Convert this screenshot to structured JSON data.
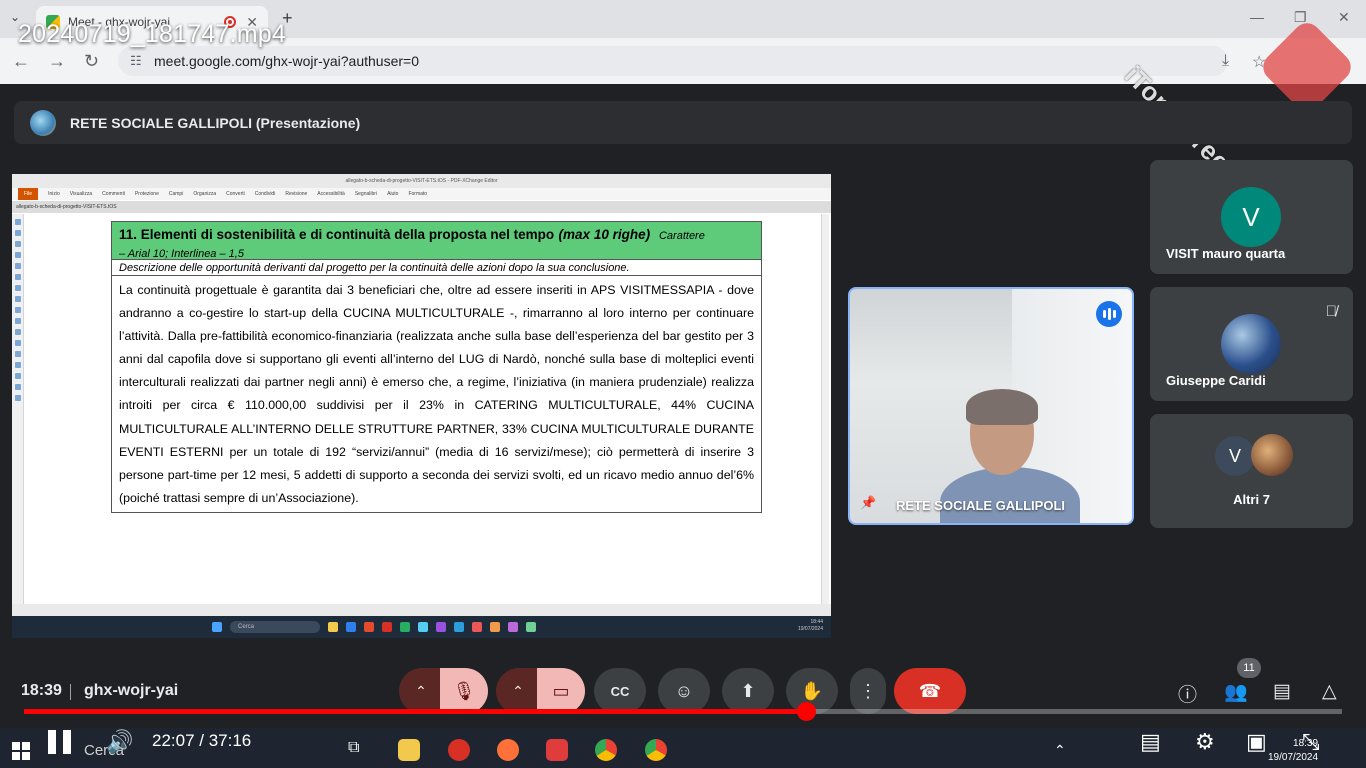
{
  "browser": {
    "tab_title": "Meet - ghx-wojr-yai",
    "url": "meet.google.com/ghx-wojr-yai?authuser=0",
    "tab_close": "✕",
    "new_tab": "+",
    "back": "←",
    "forward": "→",
    "reload": "↻",
    "minimize": "—",
    "maximize": "❐",
    "close": "✕"
  },
  "video": {
    "filename": "20240719_181747.mp4",
    "current_time": "22:07",
    "duration": "37:16",
    "time_display": "22:07 / 37:16",
    "progress_fraction": 0.593
  },
  "meet": {
    "meeting_title": "RETE SOCIALE GALLIPOLI (Presentazione)",
    "clock": "18:39",
    "meeting_code": "ghx-wojr-yai",
    "participants_count": "11"
  },
  "presentation": {
    "pdf_window_title": "allegato-b-scheda-di-progetto-VISIT-ETS.tOS - PDF-XChange Editor",
    "pdf_tab": "allegato-b-scheda-di-progetto-VISIT-ETS.tOS",
    "ribbon": [
      "File",
      "Inizio",
      "Visualizza",
      "Commenti",
      "Protezione",
      "Campi",
      "Organizza",
      "Converti",
      "Condividi",
      "Revisione",
      "Accessibilità",
      "Segnalibri",
      "Aiuto",
      "Formato"
    ],
    "taskbar_search": "Cerca",
    "mini_clock": "18:44",
    "mini_date": "19/07/2024",
    "section_heading": "11. Elementi di sostenibilità e di continuità della proposta nel tempo",
    "section_heading_limit": "(max 10 righe)",
    "section_heading_note": "Carattere",
    "section_heading_note2": "– Arial 10; Interlinea – 1,5",
    "description": "Descrizione delle opportunità derivanti dal progetto per la continuità delle azioni dopo la sua conclusione.",
    "body": "La continuità progettuale è garantita dai 3 beneficiari che, oltre ad essere inseriti in APS VISITMESSAPIA - dove andranno a co-gestire lo start-up della CUCINA MULTICULTURALE -, rimarranno al loro interno per continuare l’attività. Dalla pre-fattibilità economico-finanziaria (realizzata anche sulla base dell’esperienza del bar gestito per 3 anni dal capofila dove si supportano gli eventi all’interno del LUG di Nardò, nonché sulla base di molteplici eventi interculturali realizzati dai partner negli anni) è emerso che, a regime, l’iniziativa (in maniera prudenziale) realizza introiti per circa € 110.000,00 suddivisi per il 23% in CATERING MULTICULTURALE, 44% CUCINA MULTICULTURALE ALL’INTERNO DELLE STRUTTURE PARTNER, 33% CUCINA MULTICULTURALE DURANTE EVENTI ESTERNI per un totale di 192 “servizi/annui” (media di 16 servizi/mese); ciò permetterà di inserire 3 persone part-time per 12 mesi, 5 addetti di supporto a seconda dei servizi svolti, ed un ricavo medio annuo del’6% (poiché trattasi sempre di un’Associazione)."
  },
  "participants": {
    "tile1": {
      "initial": "V",
      "name": "VISIT mauro quarta"
    },
    "tile2": {
      "name": "Giuseppe Caridi"
    },
    "tile3": {
      "initial": "V",
      "name": "Altri 7"
    },
    "speaker": {
      "name": "RETE SOCIALE GALLIPOLI"
    }
  },
  "controls": {
    "chevron": "⌃",
    "mic_icon": "🎙",
    "cam_icon": "▭",
    "cc_label": "CC",
    "emoji_icon": "☺",
    "present_icon": "⬆",
    "hand_icon": "✋",
    "more_icon": "⋮",
    "hangup_icon": "☎",
    "info_icon": "ⓘ",
    "people_icon": "👥",
    "chat_icon": "▤",
    "activities_icon": "△"
  },
  "taskbar": {
    "search": "Cerca",
    "time": "18:39",
    "date": "19/07/2024"
  },
  "watermark": {
    "text": "iTop Screen Recorder"
  },
  "colors": {
    "meet_bg": "#202124",
    "accent_blue": "#8ab4f8",
    "hangup_red": "#d93025",
    "progress_red": "#ff0000",
    "heading_green": "#5ecb7b",
    "avatar_teal": "#00897b"
  }
}
